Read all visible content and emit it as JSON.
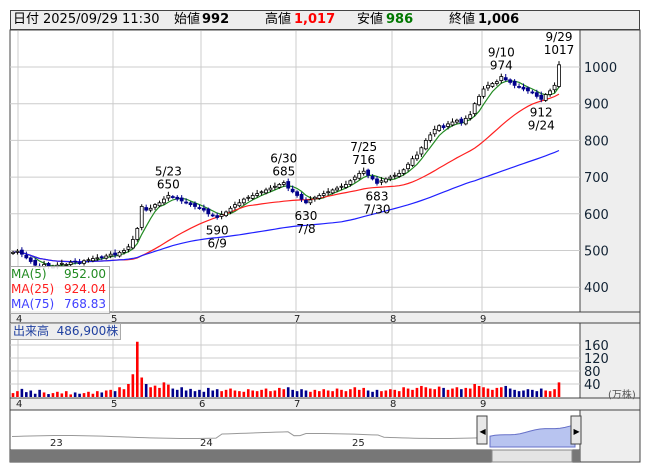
{
  "header": {
    "date_label": "日付",
    "date": "2025/09/29 11:30",
    "open_label": "始値",
    "open": "992",
    "high_label": "高値",
    "high": "1,017",
    "low_label": "安値",
    "low": "986",
    "close_label": "終値",
    "close": "1,006"
  },
  "colors": {
    "up": "#ff0000",
    "down": "#00008b",
    "ma5": "#228b22",
    "ma25": "#ff2020",
    "ma75": "#2020ff",
    "nav_fill": "#b8c4f0"
  },
  "legend": {
    "ma5_label": "MA(5)",
    "ma5": "952.00",
    "ma25_label": "MA(25)",
    "ma25": "924.04",
    "ma75_label": "MA(75)",
    "ma75": "768.83"
  },
  "volume_box": {
    "label": "出来高",
    "value": "486,900株"
  },
  "volume_unit": "(万株)",
  "months": [
    "4",
    "5",
    "6",
    "7",
    "8",
    "9"
  ],
  "navigator_labels": [
    "23",
    "24",
    "25"
  ],
  "chart_data": {
    "type": "candlestick",
    "price_ticks": [
      1000,
      900,
      800,
      700,
      600,
      500,
      400
    ],
    "volume_ticks": [
      160,
      120,
      80,
      40
    ],
    "closes": [
      495,
      498,
      490,
      480,
      470,
      460,
      455,
      462,
      458,
      455,
      460,
      465,
      462,
      468,
      470,
      465,
      472,
      475,
      478,
      480,
      482,
      485,
      490,
      488,
      495,
      500,
      510,
      530,
      560,
      620,
      610,
      615,
      625,
      630,
      640,
      650,
      645,
      640,
      635,
      630,
      625,
      620,
      615,
      610,
      600,
      595,
      590,
      598,
      605,
      615,
      625,
      630,
      640,
      645,
      650,
      655,
      660,
      665,
      670,
      675,
      680,
      685,
      670,
      660,
      650,
      640,
      630,
      638,
      645,
      650,
      655,
      660,
      665,
      670,
      675,
      680,
      690,
      700,
      710,
      716,
      705,
      695,
      683,
      690,
      695,
      700,
      705,
      710,
      720,
      735,
      750,
      760,
      780,
      800,
      815,
      830,
      840,
      835,
      845,
      850,
      855,
      848,
      860,
      870,
      900,
      920,
      940,
      950,
      955,
      960,
      974,
      965,
      958,
      950,
      945,
      940,
      935,
      930,
      920,
      912,
      925,
      935,
      950,
      1006
    ],
    "volumes": [
      12,
      18,
      25,
      15,
      20,
      10,
      22,
      14,
      9,
      12,
      16,
      11,
      18,
      8,
      14,
      10,
      12,
      16,
      10,
      18,
      14,
      20,
      22,
      18,
      30,
      24,
      40,
      70,
      170,
      60,
      40,
      30,
      35,
      28,
      45,
      38,
      26,
      22,
      30,
      20,
      25,
      18,
      22,
      16,
      28,
      20,
      24,
      18,
      22,
      26,
      20,
      18,
      16,
      24,
      20,
      18,
      22,
      26,
      18,
      20,
      28,
      24,
      30,
      22,
      18,
      24,
      20,
      16,
      22,
      18,
      24,
      20,
      18,
      26,
      22,
      18,
      24,
      30,
      22,
      28,
      20,
      16,
      22,
      18,
      20,
      24,
      22,
      18,
      30,
      26,
      22,
      28,
      34,
      30,
      26,
      24,
      32,
      28,
      22,
      26,
      30,
      24,
      28,
      26,
      40,
      34,
      30,
      26,
      22,
      28,
      30,
      34,
      26,
      22,
      18,
      20,
      24,
      22,
      18,
      26,
      20,
      18,
      24,
      45
    ],
    "annotations": [
      {
        "date": "5/23",
        "value": "650",
        "idx": 35,
        "pos": "above"
      },
      {
        "date": "6/9",
        "value": "590",
        "idx": 46,
        "pos": "below"
      },
      {
        "date": "6/30",
        "value": "685",
        "idx": 61,
        "pos": "above"
      },
      {
        "date": "7/8",
        "value": "630",
        "idx": 66,
        "pos": "below"
      },
      {
        "date": "7/25",
        "value": "716",
        "idx": 79,
        "pos": "above"
      },
      {
        "date": "7/30",
        "value": "683",
        "idx": 82,
        "pos": "below"
      },
      {
        "date": "9/10",
        "value": "974",
        "idx": 110,
        "pos": "above"
      },
      {
        "date": "9/24",
        "value": "912",
        "idx": 119,
        "pos": "below"
      },
      {
        "date": "9/29",
        "value": "1017",
        "idx": 123,
        "pos": "above"
      }
    ]
  }
}
